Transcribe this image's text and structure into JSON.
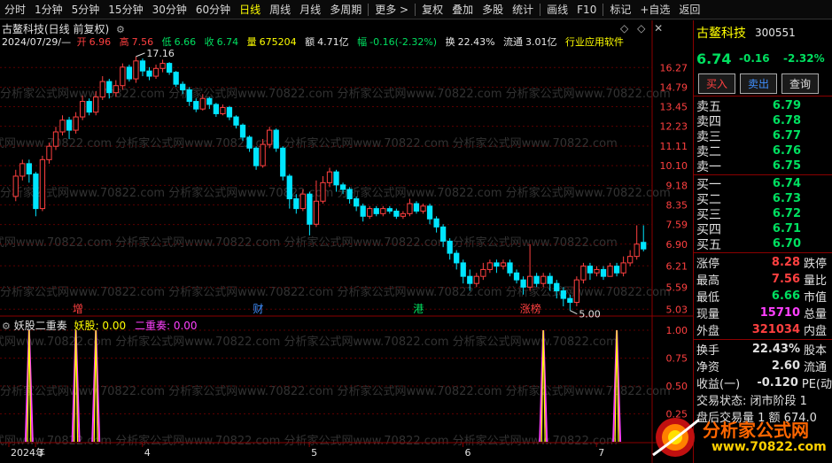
{
  "toolbar": {
    "items": [
      "分时",
      "1分钟",
      "5分钟",
      "15分钟",
      "30分钟",
      "60分钟",
      "日线",
      "周线",
      "月线",
      "多周期",
      "更多 >",
      "复权",
      "叠加",
      "多股",
      "统计",
      "画线",
      "F10",
      "标记",
      "+自选",
      "返回"
    ],
    "active": "日线"
  },
  "header": {
    "title": "古鳌科技(日线 前复权)",
    "date": "2024/07/29/—",
    "open_label": "开",
    "open": "6.96",
    "high_label": "高",
    "high": "7.56",
    "low_label": "低",
    "low": "6.66",
    "close_label": "收",
    "close": "6.74",
    "vol_label": "量",
    "vol": "675204",
    "amount_label": "额",
    "amount": "4.71亿",
    "change_label": "幅",
    "change": "-0.16(-2.32%)",
    "turnover_label": "换",
    "turnover": "22.43%",
    "float_label": "流通",
    "float": "3.01亿",
    "industry": "行业应用软件"
  },
  "chart_data": [
    {
      "type": "candlestick",
      "title": "古鳌科技(日线 前复权)",
      "y_ticks": [
        "16.27",
        "14.79",
        "13.45",
        "12.23",
        "11.11",
        "10.10",
        "9.18",
        "8.35",
        "7.59",
        "6.90",
        "6.21",
        "5.59",
        "5.03"
      ],
      "y_scale": "log",
      "ylim": [
        4.95,
        17.6
      ],
      "x_labels": [
        "2024年",
        "3",
        "4",
        "5",
        "6",
        "7"
      ],
      "max_annotation": "17.16",
      "min_annotation": "5.00",
      "event_tags": [
        {
          "text": "增",
          "color": "#ff4040"
        },
        {
          "text": "财",
          "color": "#4090ff"
        },
        {
          "text": "港",
          "color": "#00e060"
        },
        {
          "text": "涨榜",
          "color": "#ff4040"
        }
      ],
      "candles": [
        [
          8.7,
          9.6,
          9.9,
          8.5
        ],
        [
          9.6,
          10.2,
          10.4,
          9.4
        ],
        [
          10.2,
          9.7,
          10.4,
          9.3
        ],
        [
          9.7,
          8.2,
          9.8,
          7.9
        ],
        [
          8.2,
          10.4,
          10.6,
          8.1
        ],
        [
          10.4,
          11.1,
          11.3,
          10.2
        ],
        [
          11.1,
          11.9,
          12.2,
          10.9
        ],
        [
          11.9,
          12.6,
          12.9,
          11.7
        ],
        [
          12.6,
          12.0,
          12.8,
          11.5
        ],
        [
          12.0,
          12.8,
          13.1,
          11.8
        ],
        [
          12.8,
          13.8,
          14.2,
          12.6
        ],
        [
          13.8,
          13.1,
          14.0,
          12.9
        ],
        [
          13.1,
          14.1,
          14.5,
          12.9
        ],
        [
          14.1,
          15.2,
          15.6,
          13.9
        ],
        [
          15.2,
          14.4,
          15.4,
          14.0
        ],
        [
          14.4,
          14.9,
          15.3,
          14.1
        ],
        [
          14.9,
          16.3,
          16.6,
          14.6
        ],
        [
          16.3,
          15.4,
          16.5,
          15.2
        ],
        [
          15.4,
          16.8,
          17.16,
          15.1
        ],
        [
          16.8,
          16.0,
          17.0,
          15.6
        ],
        [
          16.0,
          15.6,
          16.3,
          15.3
        ],
        [
          15.6,
          16.2,
          16.5,
          15.4
        ],
        [
          16.2,
          16.6,
          16.9,
          15.9
        ],
        [
          16.6,
          15.9,
          16.7,
          15.7
        ],
        [
          15.9,
          15.0,
          16.0,
          14.8
        ],
        [
          15.0,
          14.6,
          15.2,
          14.3
        ],
        [
          14.6,
          13.8,
          14.8,
          13.5
        ],
        [
          13.8,
          13.3,
          14.0,
          13.1
        ],
        [
          13.3,
          14.0,
          14.3,
          13.2
        ],
        [
          14.0,
          13.6,
          14.1,
          13.3
        ],
        [
          13.6,
          13.0,
          13.7,
          12.8
        ],
        [
          13.0,
          13.4,
          13.6,
          12.9
        ],
        [
          13.4,
          12.8,
          13.5,
          12.6
        ],
        [
          12.8,
          12.3,
          12.9,
          12.1
        ],
        [
          12.3,
          11.6,
          12.4,
          11.4
        ],
        [
          11.6,
          11.0,
          11.7,
          10.8
        ],
        [
          11.0,
          10.1,
          11.1,
          9.9
        ],
        [
          10.1,
          11.2,
          11.5,
          10.0
        ],
        [
          11.2,
          12.0,
          12.2,
          11.0
        ],
        [
          12.0,
          11.0,
          12.1,
          10.8
        ],
        [
          11.0,
          9.6,
          11.1,
          9.4
        ],
        [
          9.6,
          8.6,
          9.7,
          8.2
        ],
        [
          8.6,
          8.2,
          8.8,
          8.0
        ],
        [
          8.2,
          8.8,
          9.0,
          8.1
        ],
        [
          8.8,
          7.6,
          8.9,
          7.2
        ],
        [
          7.6,
          8.5,
          9.4,
          7.5
        ],
        [
          8.5,
          9.3,
          9.6,
          8.4
        ],
        [
          9.3,
          9.8,
          10.0,
          9.1
        ],
        [
          9.8,
          9.2,
          9.9,
          8.9
        ],
        [
          9.2,
          9.0,
          9.3,
          8.8
        ],
        [
          9.0,
          8.6,
          9.1,
          8.4
        ],
        [
          8.6,
          8.3,
          8.7,
          8.1
        ],
        [
          8.3,
          7.9,
          8.4,
          7.7
        ],
        [
          7.9,
          8.2,
          8.3,
          7.8
        ],
        [
          8.2,
          8.0,
          8.3,
          7.9
        ],
        [
          8.0,
          8.2,
          8.3,
          7.9
        ],
        [
          8.2,
          8.1,
          8.3,
          8.0
        ],
        [
          8.1,
          7.9,
          8.2,
          7.8
        ],
        [
          7.9,
          8.0,
          8.1,
          7.8
        ],
        [
          8.0,
          8.4,
          8.6,
          7.9
        ],
        [
          8.4,
          8.1,
          8.5,
          8.0
        ],
        [
          8.1,
          8.3,
          8.4,
          8.0
        ],
        [
          8.3,
          7.8,
          8.4,
          7.6
        ],
        [
          7.8,
          7.5,
          7.9,
          7.3
        ],
        [
          7.5,
          7.0,
          7.6,
          6.8
        ],
        [
          7.0,
          6.6,
          7.1,
          6.4
        ],
        [
          6.6,
          6.3,
          6.7,
          6.1
        ],
        [
          6.3,
          5.9,
          6.4,
          5.7
        ],
        [
          5.9,
          5.7,
          6.1,
          5.5
        ],
        [
          5.7,
          5.9,
          6.0,
          5.6
        ],
        [
          5.9,
          6.1,
          6.3,
          5.8
        ],
        [
          6.1,
          6.3,
          6.4,
          6.0
        ],
        [
          6.3,
          6.2,
          6.4,
          6.0
        ],
        [
          6.2,
          6.3,
          6.4,
          6.1
        ],
        [
          6.3,
          6.0,
          6.4,
          5.9
        ],
        [
          6.0,
          5.8,
          6.1,
          5.7
        ],
        [
          5.8,
          5.6,
          5.9,
          5.4
        ],
        [
          5.6,
          5.9,
          6.9,
          5.5
        ],
        [
          5.9,
          5.7,
          6.0,
          5.6
        ],
        [
          5.7,
          5.9,
          6.0,
          5.6
        ],
        [
          5.9,
          5.7,
          6.0,
          5.5
        ],
        [
          5.7,
          5.5,
          5.8,
          5.3
        ],
        [
          5.5,
          5.3,
          5.6,
          5.1
        ],
        [
          5.3,
          5.2,
          5.4,
          5.0
        ],
        [
          5.2,
          5.8,
          5.9,
          5.1
        ],
        [
          5.8,
          6.2,
          6.3,
          5.7
        ],
        [
          6.2,
          6.0,
          6.3,
          5.8
        ],
        [
          6.0,
          6.1,
          6.2,
          5.9
        ],
        [
          6.1,
          5.9,
          6.2,
          5.8
        ],
        [
          5.9,
          6.2,
          6.3,
          5.9
        ],
        [
          6.2,
          6.0,
          6.3,
          5.9
        ],
        [
          6.0,
          6.3,
          6.5,
          5.9
        ],
        [
          6.3,
          6.5,
          6.7,
          6.2
        ],
        [
          6.5,
          6.9,
          7.56,
          6.4
        ],
        [
          6.96,
          6.74,
          7.56,
          6.66
        ]
      ]
    },
    {
      "type": "line",
      "title": "妖股二重奏",
      "series": [
        {
          "name": "妖股",
          "color": "#ffff00",
          "value_label": "0.00"
        },
        {
          "name": "二重奏",
          "color": "#ff40ff",
          "value_label": "0.00"
        }
      ],
      "y_ticks": [
        "1.00",
        "0.75",
        "0.50",
        "0.25"
      ],
      "ylim": [
        0,
        1.0
      ],
      "signals": [
        2,
        9,
        12,
        79,
        90
      ]
    }
  ],
  "panel": {
    "name": "古鳌科技",
    "code": "300551",
    "price": "6.74",
    "change": "-0.16",
    "change_pct": "-2.32%",
    "buy_btn": "买入",
    "sell_btn": "卖出",
    "query_btn": "查询",
    "asks": [
      {
        "label": "卖五",
        "price": "6.79"
      },
      {
        "label": "卖四",
        "price": "6.78"
      },
      {
        "label": "卖三",
        "price": "6.77"
      },
      {
        "label": "卖二",
        "price": "6.76"
      },
      {
        "label": "卖一",
        "price": "6.75"
      }
    ],
    "bids": [
      {
        "label": "买一",
        "price": "6.74"
      },
      {
        "label": "买二",
        "price": "6.73"
      },
      {
        "label": "买三",
        "price": "6.72"
      },
      {
        "label": "买四",
        "price": "6.71"
      },
      {
        "label": "买五",
        "price": "6.70"
      }
    ],
    "stats": [
      {
        "label": "涨停",
        "value": "8.28",
        "color": "#ff4040",
        "label2": "跌停"
      },
      {
        "label": "最高",
        "value": "7.56",
        "color": "#ff4040",
        "label2": "量比"
      },
      {
        "label": "最低",
        "value": "6.66",
        "color": "#00e060",
        "label2": "市值"
      },
      {
        "label": "现量",
        "value": "15710",
        "color": "#ff40ff",
        "label2": "总量"
      },
      {
        "label": "外盘",
        "value": "321034",
        "color": "#ff4040",
        "label2": "内盘"
      }
    ],
    "stats2": [
      {
        "label": "换手",
        "value": "22.43%",
        "color": "#e0e0e0",
        "label2": "股本"
      },
      {
        "label": "净资",
        "value": "2.60",
        "color": "#e0e0e0",
        "label2": "流通"
      },
      {
        "label": "收益(一)",
        "value": "-0.120",
        "color": "#e0e0e0",
        "label2": "PE(动"
      }
    ],
    "trade_status": "交易状态: 闭市阶段 1",
    "after_hours": "盘后交易量 1 额 674.0"
  },
  "watermark": "分析家公式网www.70822.com",
  "logo": {
    "line1": "分析家公式网",
    "line2": "www.70822.com"
  },
  "colors": {
    "up": "#ff4040",
    "down": "#00e5ff",
    "grid": "#8b0000",
    "yellow": "#ffff00",
    "magenta": "#ff40ff"
  }
}
